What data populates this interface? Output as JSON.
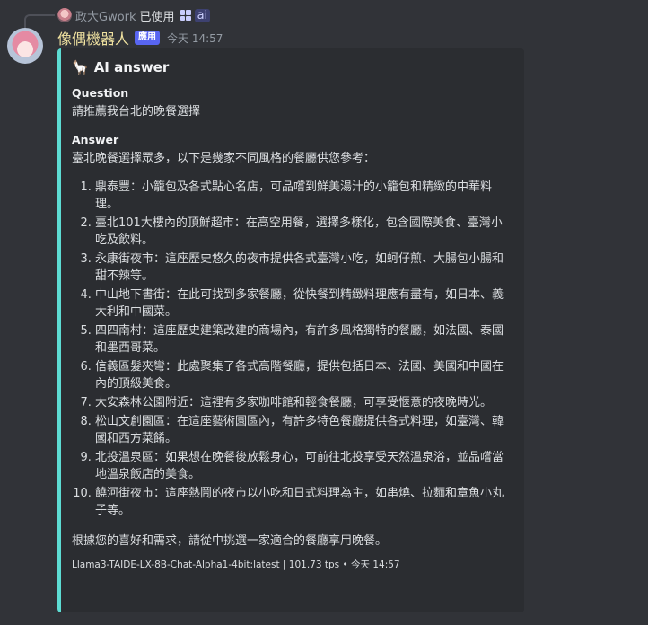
{
  "reply": {
    "user": "政大Gwork",
    "used_text": "已使用",
    "command": "ai"
  },
  "message": {
    "bot_name": "像偶機器人",
    "badge": "應用",
    "timestamp": "今天 14:57"
  },
  "embed": {
    "accent_color": "#5ddcd3",
    "icon": "llama-icon",
    "title": "AI answer",
    "question_label": "Question",
    "question": "請推薦我台北的晚餐選擇",
    "answer_label": "Answer",
    "answer_intro": "臺北晚餐選擇眾多，以下是幾家不同風格的餐廳供您參考：",
    "items": [
      "鼎泰豐：小籠包及各式點心名店，可品嚐到鮮美湯汁的小籠包和精緻的中華料理。",
      "臺北101大樓內的頂鮮超市：在高空用餐，選擇多樣化，包含國際美食、臺灣小吃及飲料。",
      "永康街夜市：這座歷史悠久的夜市提供各式臺灣小吃，如蚵仔煎、大腸包小腸和甜不辣等。",
      "中山地下書街：在此可找到多家餐廳，從快餐到精緻料理應有盡有，如日本、義大利和中國菜。",
      "四四南村：這座歷史建築改建的商場內，有許多風格獨特的餐廳，如法國、泰國和墨西哥菜。",
      "信義區髮夾彎：此處聚集了各式高階餐廳，提供包括日本、法國、美國和中國在內的頂級美食。",
      "大安森林公園附近：這裡有多家咖啡館和輕食餐廳，可享受愜意的夜晚時光。",
      "松山文創園區：在這座藝術園區內，有許多特色餐廳提供各式料理，如臺灣、韓國和西方菜餚。",
      "北投溫泉區：如果想在晚餐後放鬆身心，可前往北投享受天然溫泉浴，並品嚐當地溫泉飯店的美食。",
      "饒河街夜市：這座熱鬧的夜市以小吃和日式料理為主，如串燒、拉麵和章魚小丸子等。"
    ],
    "closing": "根據您的喜好和需求，請從中挑選一家適合的餐廳享用晚餐。",
    "footer": "Llama3-TAIDE-LX-8B-Chat-Alpha1-4bit:latest | 101.73 tps • 今天 14:57"
  }
}
